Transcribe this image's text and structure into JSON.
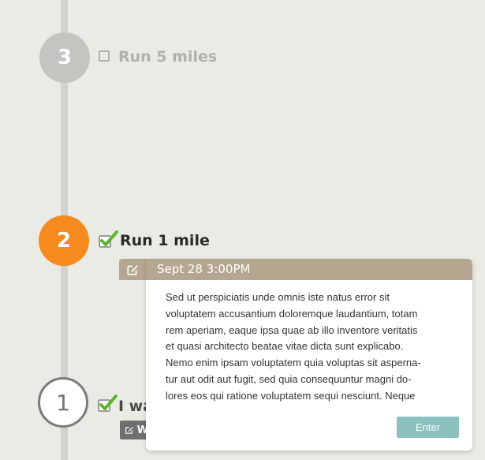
{
  "timeline": {
    "steps": [
      {
        "number": "3",
        "label": "Run 5 miles",
        "status": "unchecked"
      },
      {
        "number": "2",
        "label": "Run 1 mile",
        "status": "checked"
      },
      {
        "number": "1",
        "label": "I wa",
        "status": "checked"
      }
    ]
  },
  "popover": {
    "timestamp": "Sept 28 3:00PM",
    "lines": [
      "Sed ut perspiciatis unde omnis iste natus error sit",
      "voluptatem accusantium doloremque laudantium, totam",
      "rem aperiam, eaque ipsa quae ab illo inventore veritatis",
      "et quasi architecto beatae vitae dicta sunt explicabo.",
      "Nemo enim ipsam voluptatem quia voluptas sit asperna-",
      "tur aut odit aut fugit, sed quia consequuntur magni do-",
      "lores eos qui ratione voluptatem sequi nesciunt. Neque"
    ],
    "enter_label": "Enter",
    "header_color": "#b5a68f",
    "button_color": "#8bc0be"
  },
  "entry_tag": {
    "partial_text": "W"
  },
  "colors": {
    "accent_active": "#f58a1f",
    "check_green": "#5cb531",
    "inactive": "#c4c4c0"
  },
  "icons": [
    "edit-icon",
    "check-icon"
  ]
}
